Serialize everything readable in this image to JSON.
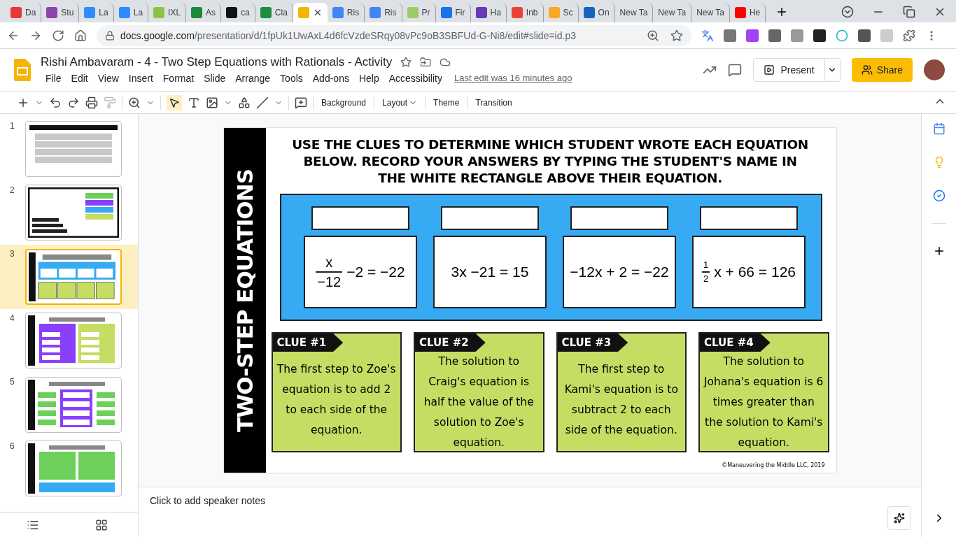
{
  "browser": {
    "tabs": [
      {
        "label": "Da",
        "color": "#e53935",
        "selected": false
      },
      {
        "label": "Stu",
        "color": "#8e44ad",
        "selected": false
      },
      {
        "label": "La",
        "color": "#2d8cff",
        "selected": false
      },
      {
        "label": "La",
        "color": "#2d8cff",
        "selected": false
      },
      {
        "label": "IXL",
        "color": "#8bc34a",
        "selected": false
      },
      {
        "label": "As",
        "color": "#1b8a3a",
        "selected": false
      },
      {
        "label": "ca",
        "color": "#111111",
        "selected": false
      },
      {
        "label": "Cla",
        "color": "#1e8e3e",
        "selected": false
      },
      {
        "color": "#f4b400",
        "selected": true
      },
      {
        "label": "Ris",
        "color": "#4285f4",
        "selected": false
      },
      {
        "label": "Ris",
        "color": "#4285f4",
        "selected": false
      },
      {
        "label": "Pr",
        "color": "#9ccc65",
        "selected": false
      },
      {
        "label": "Fir",
        "color": "#1a73e8",
        "selected": false
      },
      {
        "label": "Ha",
        "color": "#673ab7",
        "selected": false
      },
      {
        "label": "Inb",
        "color": "#ea4335",
        "selected": false
      },
      {
        "label": "Sc",
        "color": "#f9a825",
        "selected": false
      },
      {
        "label": "On",
        "color": "#1565c0",
        "selected": false
      },
      {
        "label": "New Ta",
        "selected": false
      },
      {
        "label": "New Ta",
        "selected": false
      },
      {
        "label": "New Ta",
        "selected": false
      },
      {
        "label": "He",
        "color": "#ff0000",
        "selected": false
      }
    ],
    "url_host": "docs.google.com",
    "url_path": "/presentation/d/1fpUk1UwAxL4d6fcVzdeSRqy08vPc9oB3SBFUd-G-Ni8/edit#slide=id.p3"
  },
  "document": {
    "title": "Rishi Ambavaram - 4 - Two Step Equations with Rationals - Activity",
    "menu": [
      "File",
      "Edit",
      "View",
      "Insert",
      "Format",
      "Slide",
      "Arrange",
      "Tools",
      "Add-ons",
      "Help",
      "Accessibility"
    ],
    "last_edit": "Last edit was 16 minutes ago",
    "present": "Present",
    "share": "Share"
  },
  "toolbar": {
    "buttons": [
      {
        "label": "Background",
        "dropdown": false
      },
      {
        "label": "Layout",
        "dropdown": true
      },
      {
        "label": "Theme",
        "dropdown": false
      },
      {
        "label": "Transition",
        "dropdown": false
      }
    ]
  },
  "filmstrip": [
    {
      "number": "1",
      "kind": "instructions",
      "selected": false
    },
    {
      "number": "2",
      "kind": "title",
      "selected": false
    },
    {
      "number": "3",
      "kind": "clues",
      "selected": true
    },
    {
      "number": "4",
      "kind": "sort",
      "selected": false
    },
    {
      "number": "5",
      "kind": "match",
      "selected": false
    },
    {
      "number": "6",
      "kind": "groups",
      "selected": false
    }
  ],
  "slide": {
    "side_title": "TWO-STEP EQUATIONS",
    "heading": "USE THE CLUES TO DETERMINE WHICH STUDENT WROTE EACH EQUATION BELOW. RECORD YOUR ANSWERS BY TYPING THE STUDENT'S NAME IN THE WHITE RECTANGLE ABOVE THEIR EQUATION.",
    "equations": [
      {
        "kind": "fraction",
        "numerator": "x",
        "denominator": "−12",
        "rest": "−2  = −22"
      },
      {
        "kind": "plain",
        "text": "3x −21 = 15"
      },
      {
        "kind": "plain",
        "text": "−12x + 2 = −22"
      },
      {
        "kind": "small-fraction",
        "numerator": "1",
        "denominator": "2",
        "rest": "x + 66 = 126"
      }
    ],
    "clues": [
      {
        "label": "CLUE #1",
        "text": "The first step to Zoe's equation is to add 2 to each side of the equation."
      },
      {
        "label": "CLUE #2",
        "text": "The solution to Craig's equation is half the value of the solution to Zoe's equation."
      },
      {
        "label": "CLUE #3",
        "text": "The first step to Kami's equation is to subtract 2 to each side of the equation."
      },
      {
        "label": "CLUE #4",
        "text": "The solution to Johana's equation is 6 times greater than the solution to Kami's equation."
      }
    ],
    "copyright": "©Maneuvering the Middle LLC, 2019"
  },
  "notes": {
    "placeholder": "Click to add speaker notes"
  }
}
